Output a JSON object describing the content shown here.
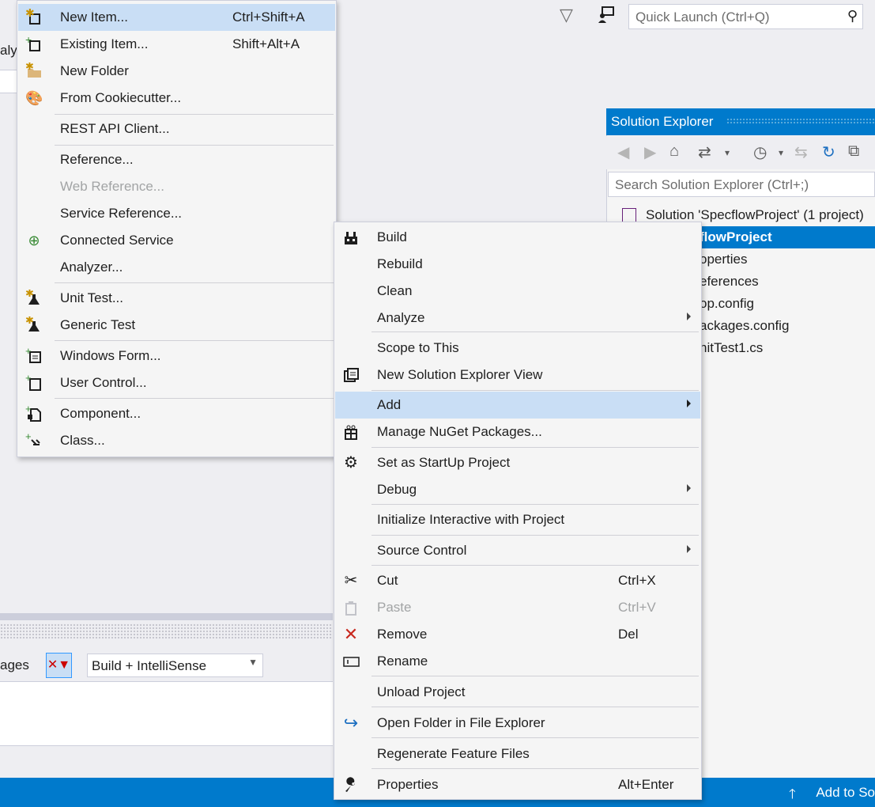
{
  "header": {
    "quick_launch_placeholder": "Quick Launch (Ctrl+Q)",
    "left_partial_text": "aly"
  },
  "solution_explorer": {
    "title": "Solution Explorer",
    "search_placeholder": "Search Solution Explorer (Ctrl+;)",
    "tree": [
      {
        "label": "Solution 'SpecflowProject' (1 project)"
      },
      {
        "label": "flowProject",
        "selected": true
      },
      {
        "label": "operties"
      },
      {
        "label": "eferences"
      },
      {
        "label": "op.config"
      },
      {
        "label": "ackages.config"
      },
      {
        "label": "nitTest1.cs"
      }
    ]
  },
  "bottom_panel": {
    "pages_text": "ages",
    "build_filter_value": "Build + IntelliSense"
  },
  "status_bar": {
    "text": "Add to So"
  },
  "add_submenu": {
    "items": [
      {
        "label": "New Item...",
        "shortcut": "Ctrl+Shift+A",
        "icon": "new-item-icon",
        "highlighted": true
      },
      {
        "label": "Existing Item...",
        "shortcut": "Shift+Alt+A",
        "icon": "existing-item-icon"
      },
      {
        "label": "New Folder",
        "icon": "new-folder-icon"
      },
      {
        "label": "From Cookiecutter...",
        "icon": "cookiecutter-icon"
      },
      {
        "label": "REST API Client..."
      },
      {
        "label": "Reference..."
      },
      {
        "label": "Web Reference...",
        "disabled": true
      },
      {
        "label": "Service Reference..."
      },
      {
        "label": "Connected Service",
        "icon": "connected-service-icon"
      },
      {
        "label": "Analyzer..."
      },
      {
        "label": "Unit Test...",
        "icon": "unit-test-icon"
      },
      {
        "label": "Generic Test",
        "icon": "generic-test-icon"
      },
      {
        "label": "Windows Form...",
        "icon": "windows-form-icon"
      },
      {
        "label": "User Control...",
        "icon": "user-control-icon"
      },
      {
        "label": "Component...",
        "icon": "component-icon"
      },
      {
        "label": "Class...",
        "icon": "class-icon"
      }
    ]
  },
  "project_context_menu": {
    "items": [
      {
        "label": "Build",
        "icon": "build-icon"
      },
      {
        "label": "Rebuild"
      },
      {
        "label": "Clean"
      },
      {
        "label": "Analyze",
        "submenu": true
      },
      {
        "label": "Scope to This"
      },
      {
        "label": "New Solution Explorer View",
        "icon": "new-view-icon"
      },
      {
        "label": "Add",
        "submenu": true,
        "highlighted": true
      },
      {
        "label": "Manage NuGet Packages...",
        "icon": "nuget-icon"
      },
      {
        "label": "Set as StartUp Project",
        "icon": "gear-icon"
      },
      {
        "label": "Debug",
        "submenu": true
      },
      {
        "label": "Initialize Interactive with Project"
      },
      {
        "label": "Source Control",
        "submenu": true
      },
      {
        "label": "Cut",
        "shortcut": "Ctrl+X",
        "icon": "scissors-icon"
      },
      {
        "label": "Paste",
        "shortcut": "Ctrl+V",
        "icon": "paste-icon",
        "disabled": true
      },
      {
        "label": "Remove",
        "shortcut": "Del",
        "icon": "remove-icon"
      },
      {
        "label": "Rename",
        "icon": "rename-icon"
      },
      {
        "label": "Unload Project"
      },
      {
        "label": "Open Folder in File Explorer",
        "icon": "open-folder-arrow-icon"
      },
      {
        "label": "Regenerate Feature Files"
      },
      {
        "label": "Properties",
        "shortcut": "Alt+Enter",
        "icon": "wrench-icon"
      }
    ]
  },
  "colors": {
    "accent": "#007acc",
    "menu_bg": "#f5f5f5",
    "highlight": "#c9def5",
    "disabled_text": "#a2a4a5",
    "remove_red": "#c8281e"
  }
}
